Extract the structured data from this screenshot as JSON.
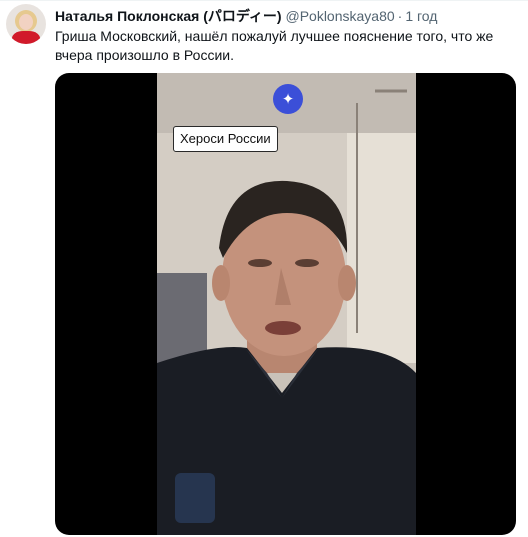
{
  "tweet": {
    "avatar_icon": "user-avatar",
    "display_name": "Наталья Поклонская (パロディー)",
    "handle": "@Poklonskaya80",
    "separator": "·",
    "time": "1 год",
    "text": "Гриша Московский, нашёл пожалуй лучшее пояснение того, что же вчера произошло в России."
  },
  "media": {
    "sparkle_icon": "sparkle-icon",
    "caption": "Хероси России"
  },
  "colors": {
    "text": "#0f1419",
    "secondary": "#536471",
    "accent": "#3b4fd8"
  }
}
